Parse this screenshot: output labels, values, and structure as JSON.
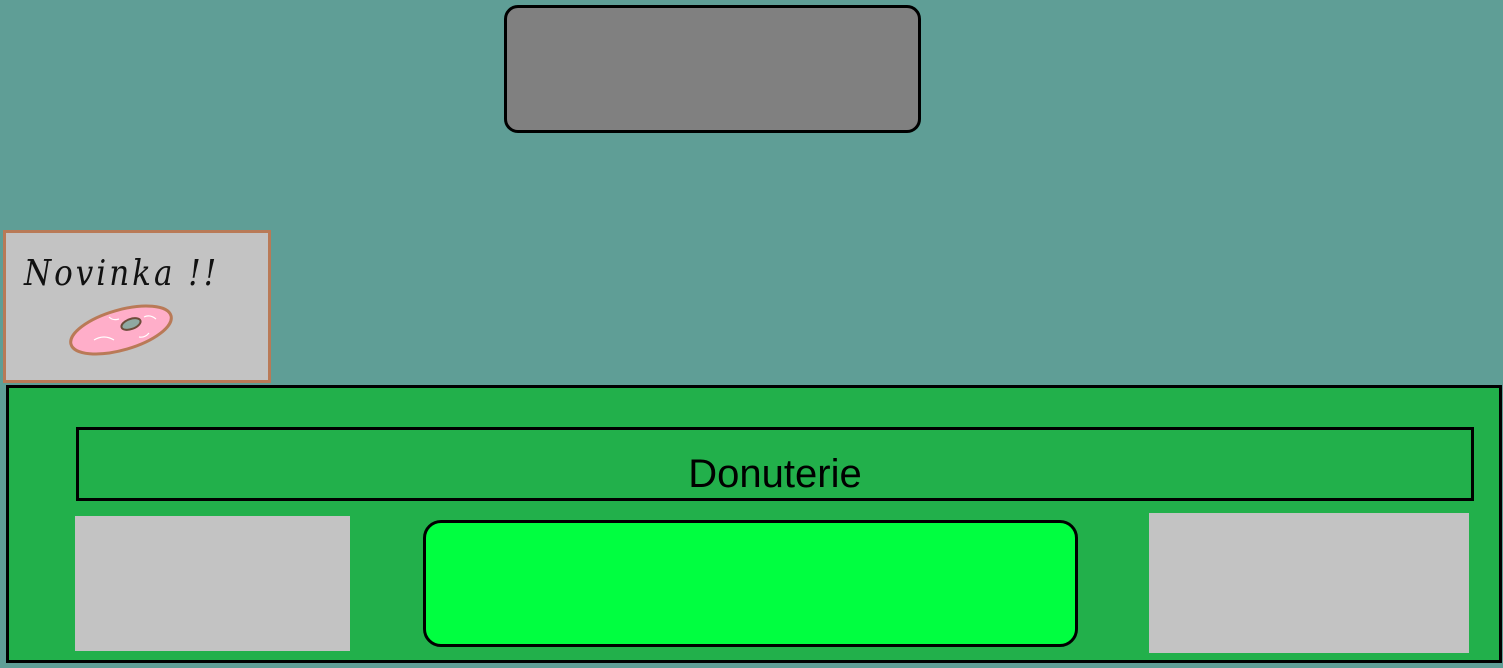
{
  "top_slot": {
    "label": ""
  },
  "news_board": {
    "title": "Novinka !!",
    "image": "pink-donut-icon"
  },
  "shop": {
    "sign_label": "Donuterie",
    "main_button_label": ""
  },
  "colors": {
    "background": "#5f9e96",
    "shop_panel": "#22b04b",
    "main_button": "#00ff40",
    "slots": "#c3c3c3",
    "top_slot": "#808080",
    "board_frame": "#b97a57",
    "donut": "#ffaec9"
  }
}
